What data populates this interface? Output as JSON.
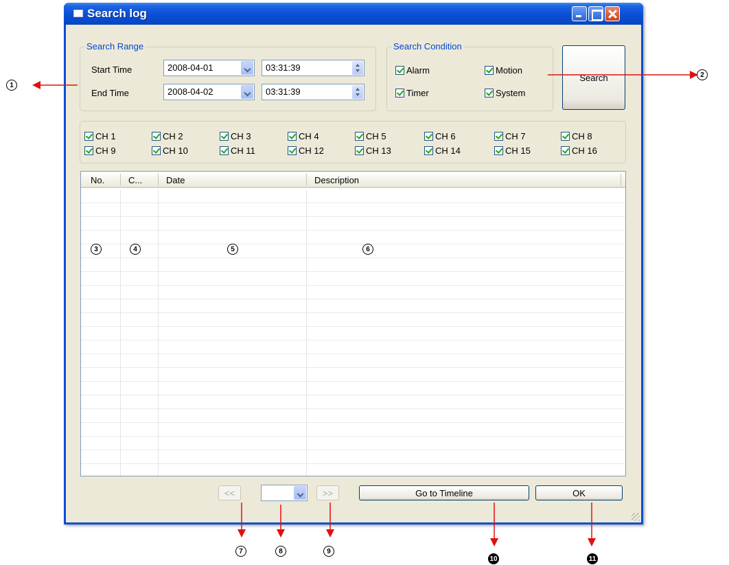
{
  "window": {
    "title": "Search log"
  },
  "search_range": {
    "label": "Search Range",
    "start_label": "Start Time",
    "start_date": "2008-04-01",
    "start_time": "03:31:39",
    "end_label": "End Time",
    "end_date": "2008-04-02",
    "end_time": "03:31:39"
  },
  "search_condition": {
    "label": "Search Condition",
    "alarm": "Alarm",
    "motion": "Motion",
    "timer": "Timer",
    "system": "System"
  },
  "search_button": "Search",
  "channels": [
    "CH 1",
    "CH 2",
    "CH 3",
    "CH 4",
    "CH 5",
    "CH 6",
    "CH 7",
    "CH 8",
    "CH 9",
    "CH 10",
    "CH 11",
    "CH 12",
    "CH 13",
    "CH 14",
    "CH 15",
    "CH 16"
  ],
  "table": {
    "columns": [
      "No.",
      "C...",
      "Date",
      "Description"
    ]
  },
  "footer": {
    "prev": "<<",
    "next": ">>",
    "page_value": "",
    "goto_timeline": "Go to Timeline",
    "ok": "OK"
  },
  "callouts": {
    "c1": "1",
    "c2": "2",
    "c3": "3",
    "c4": "4",
    "c5": "5",
    "c6": "6",
    "c7": "7",
    "c8": "8",
    "c9": "9",
    "c10": "10",
    "c11": "11"
  },
  "colors": {
    "titlebar": "#0a4fd4",
    "group_label": "#0046d5",
    "arrow": "#e01010",
    "check": "#21a121"
  }
}
